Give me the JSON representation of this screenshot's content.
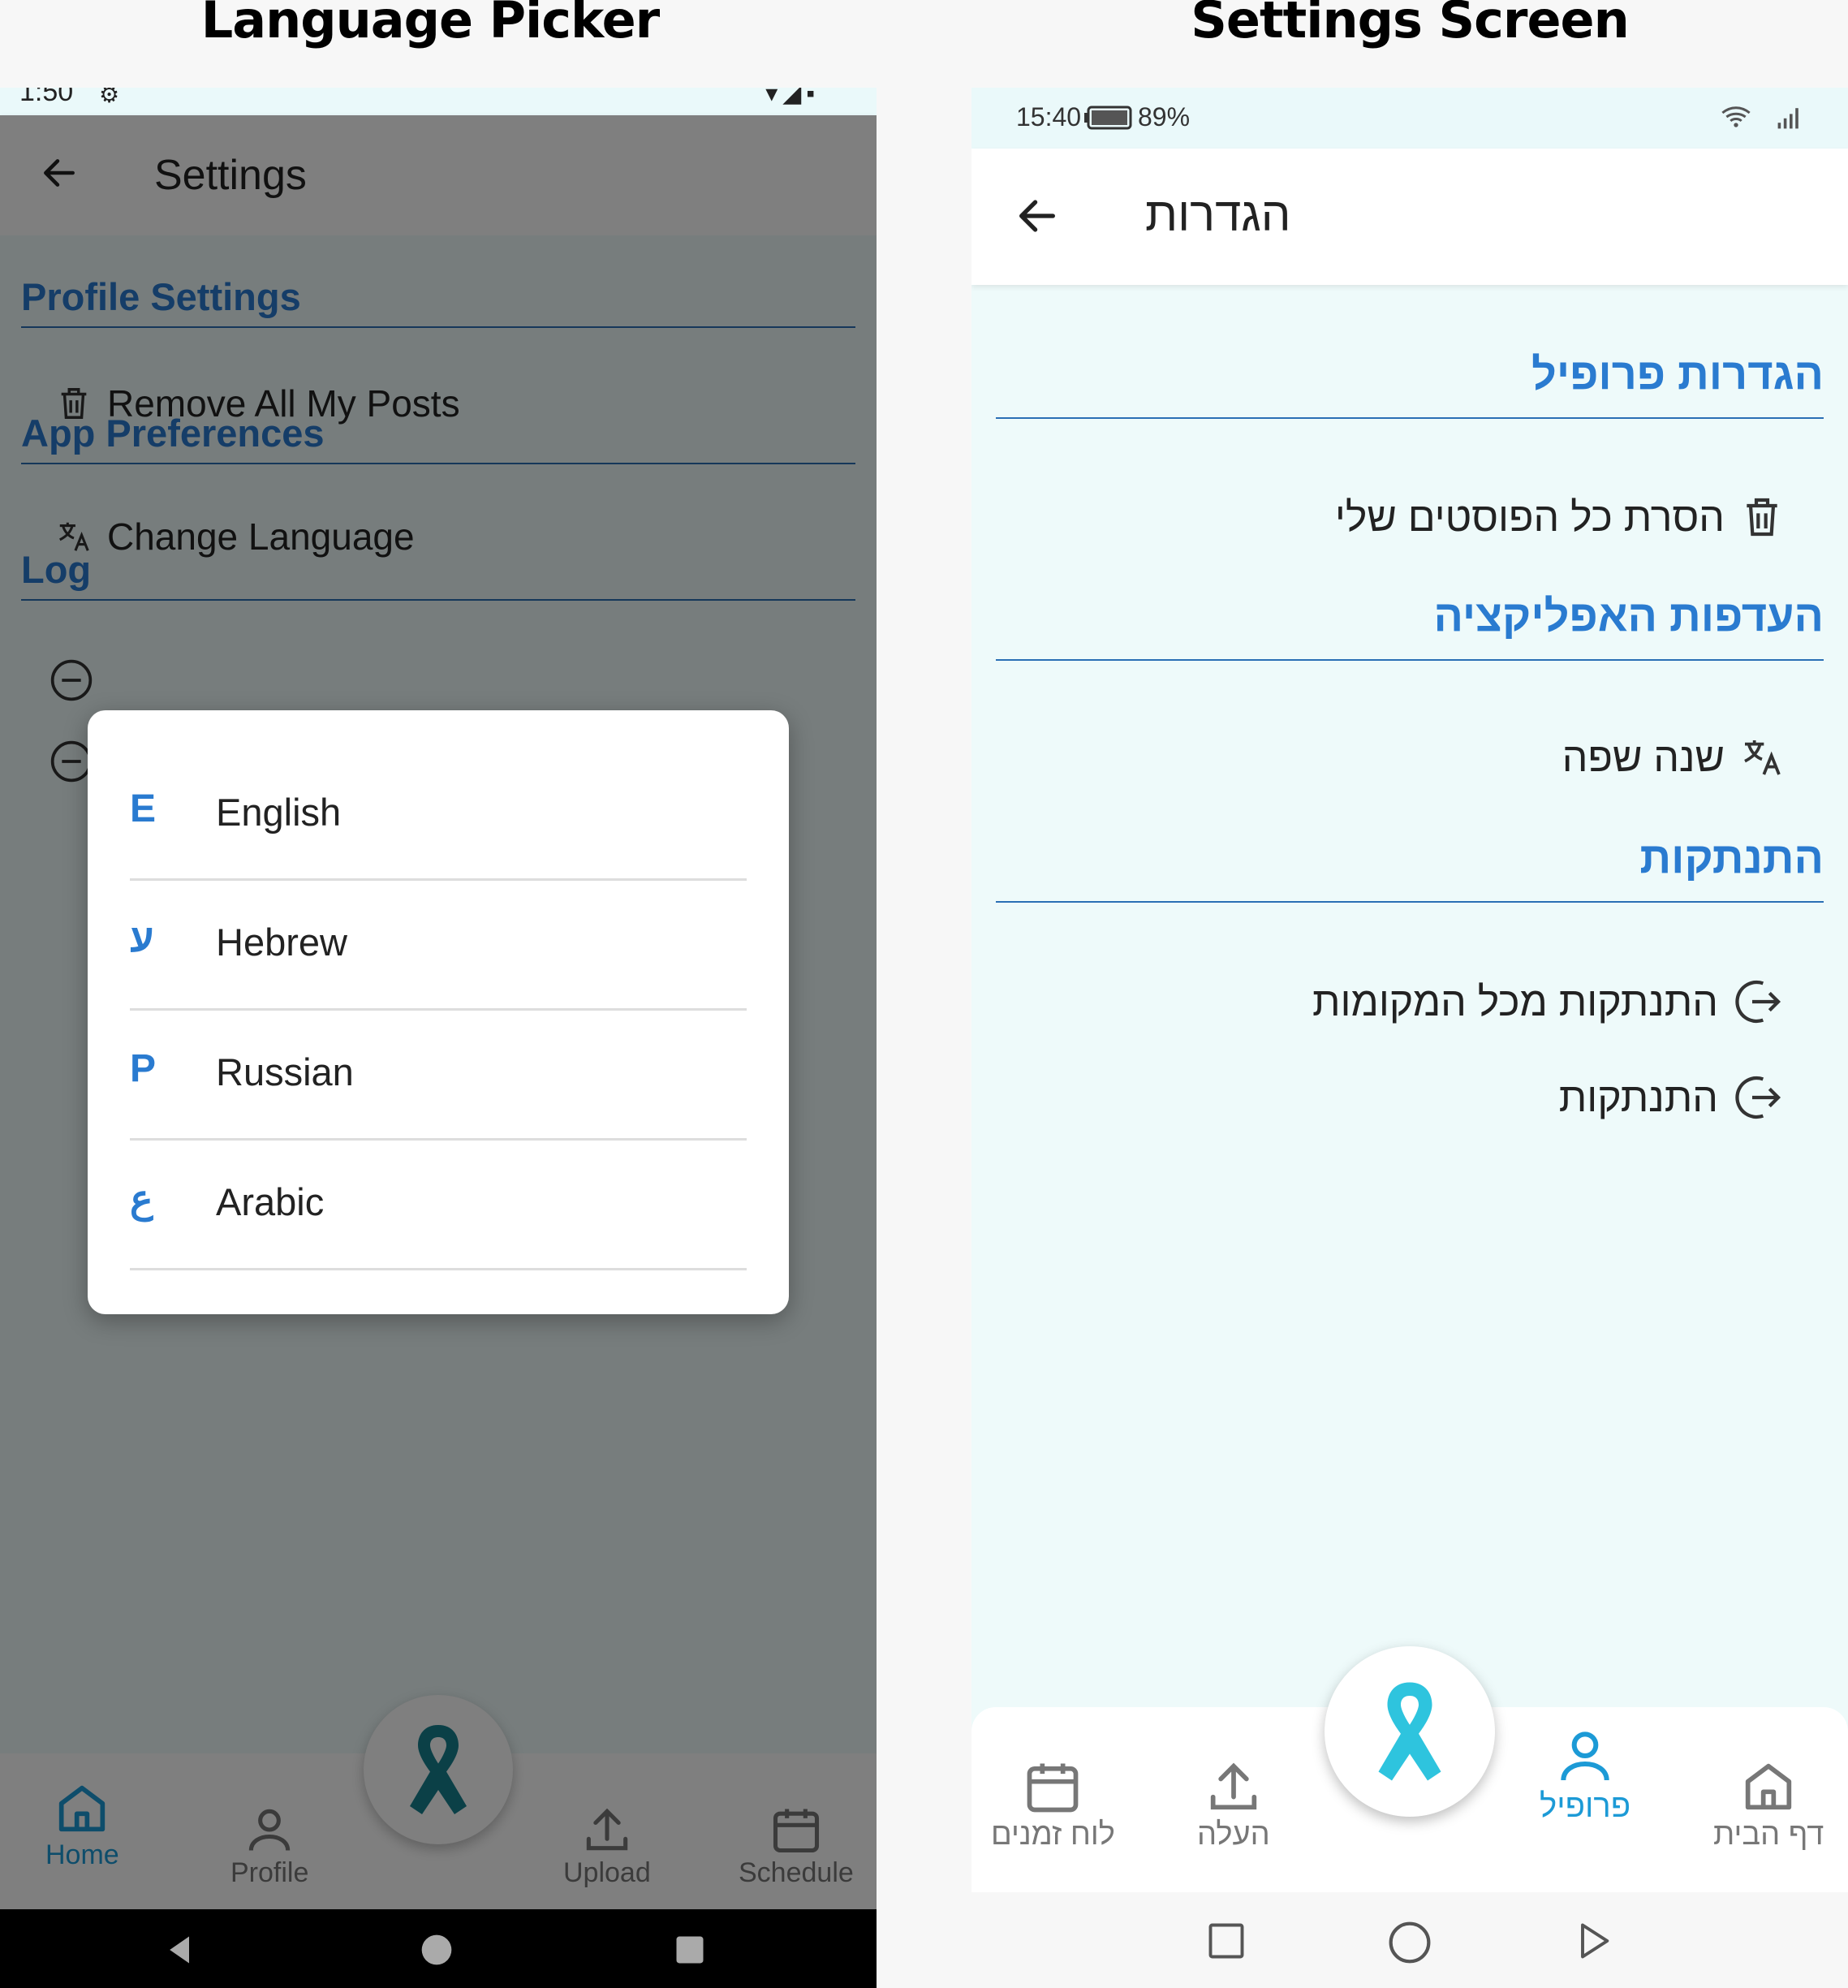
{
  "captions": {
    "left": "Language Picker",
    "right": "Settings Screen"
  },
  "left": {
    "status": {
      "time": "1:50"
    },
    "app_title": "Settings",
    "sections": {
      "profile": "Profile Settings",
      "remove_posts": "Remove All My Posts",
      "app_prefs": "App Preferences",
      "change_language": "Change Language",
      "logout_partial": "Log"
    },
    "dialog": {
      "languages": [
        {
          "glyph": "E",
          "name": "English"
        },
        {
          "glyph": "ע",
          "name": "Hebrew"
        },
        {
          "glyph": "Р",
          "name": "Russian"
        },
        {
          "glyph": "ع",
          "name": "Arabic"
        }
      ]
    },
    "nav": {
      "home": "Home",
      "profile": "Profile",
      "upload": "Upload",
      "schedule": "Schedule"
    }
  },
  "right": {
    "status": {
      "time": "15:40",
      "battery": "89%"
    },
    "app_title": "הגדרות",
    "sections": {
      "profile": "הגדרות פרופיל",
      "remove_posts": "הסרת כל הפוסטים שלי",
      "app_prefs": "העדפות האפליקציה",
      "change_language": "שנה שפה",
      "logout": "התנתקות",
      "logout_all": "התנתקות מכל המקומות",
      "logout_item": "התנתקות"
    },
    "nav": {
      "schedule": "לוח זמנים",
      "upload": "העלה",
      "profile": "פרופיל",
      "home": "דף הבית"
    }
  },
  "colors": {
    "accent": "#2a7bd0",
    "nav_active": "#1c9ad6",
    "ribbon_dark": "#17818f",
    "ribbon_light": "#2ec4de"
  }
}
